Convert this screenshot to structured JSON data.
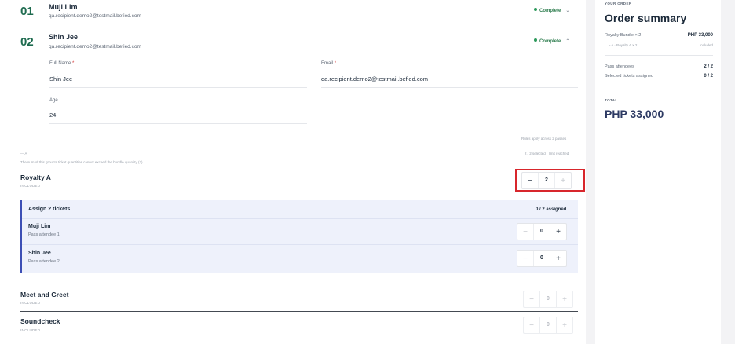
{
  "attendees": [
    {
      "number": "01",
      "name": "Muji Lim",
      "email": "qa.recipient.demo2@testmail.befied.com",
      "status": "Complete",
      "chevron": "⌄"
    },
    {
      "number": "02",
      "name": "Shin Jee",
      "email": "qa.recipient.demo2@testmail.befied.com",
      "status": "Complete",
      "chevron": "⌃"
    }
  ],
  "form": {
    "full_name_label": "Full Name",
    "full_name_value": "Shin Jee",
    "email_label": "Email",
    "email_value": "qa.recipient.demo2@testmail.befied.com",
    "age_label": "Age",
    "age_value": "24",
    "required_mark": "*"
  },
  "group": {
    "rules_note": "Rules apply across 2 passes",
    "selected_note": "2 / 2 selected · limit reached",
    "label": "— A",
    "constraint_note": "The sum of this group's ticket quantities cannot exceed the bundle quantity (2)."
  },
  "tickets": [
    {
      "name": "Royalty A",
      "sub": "INCLUDED",
      "minus": "−",
      "qty": "2",
      "plus": "+"
    },
    {
      "name": "Meet and Greet",
      "sub": "INCLUDED",
      "minus": "−",
      "qty": "0",
      "plus": "+"
    },
    {
      "name": "Soundcheck",
      "sub": "INCLUDED",
      "minus": "−",
      "qty": "0",
      "plus": "+"
    }
  ],
  "assign": {
    "title": "Assign 2 tickets",
    "count": "0 / 2 assigned",
    "rows": [
      {
        "name": "Muji Lim",
        "sub": "Pass attendee 1",
        "minus": "−",
        "qty": "0",
        "plus": "+"
      },
      {
        "name": "Shin Jee",
        "sub": "Pass attendee 2",
        "minus": "−",
        "qty": "0",
        "plus": "+"
      }
    ]
  },
  "summary": {
    "eyebrow": "YOUR ORDER",
    "title": "Order summary",
    "bundle_label": "Royalty Bundle × 2",
    "bundle_price": "PHP 33,000",
    "bundle_sub_label": "└ A · Royalty A × 2",
    "bundle_sub_value": "Included",
    "pass_attendees_label": "Pass attendees",
    "pass_attendees_value": "2 / 2",
    "tickets_assigned_label": "Selected tickets assigned",
    "tickets_assigned_value": "0 / 2",
    "total_label": "TOTAL",
    "total_value": "PHP 33,000"
  },
  "colors": {
    "accent_green": "#1e6b4f",
    "assign_bg": "#eef1fb",
    "assign_border": "#3d4fb5",
    "highlight_red": "#d8262c"
  }
}
